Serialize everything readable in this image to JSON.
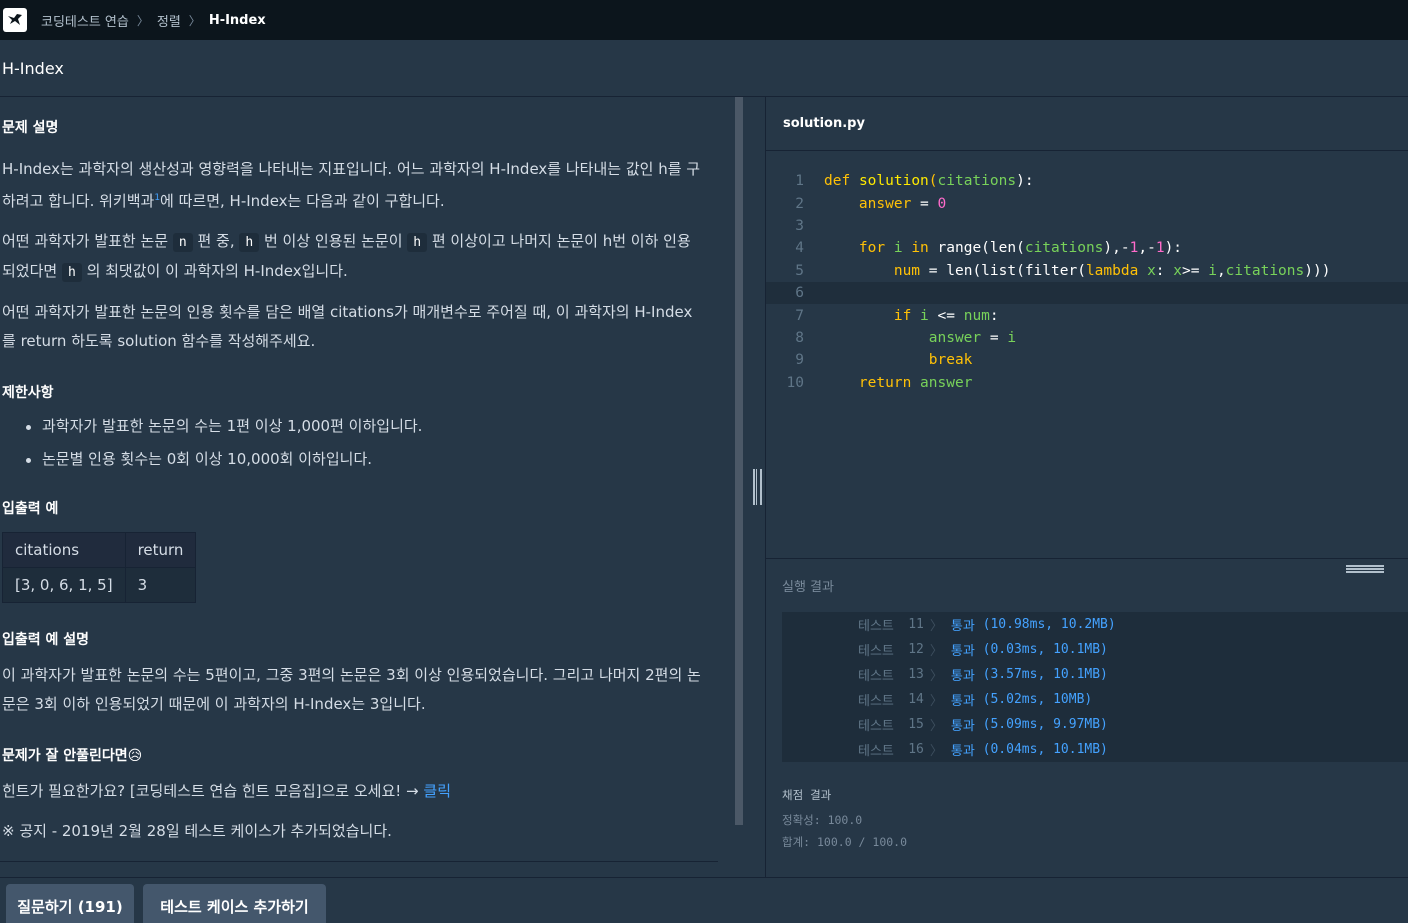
{
  "breadcrumb": {
    "items": [
      "코딩테스트 연습",
      "정렬",
      "H-Index"
    ],
    "separator": "〉"
  },
  "page": {
    "title": "H-Index"
  },
  "problem": {
    "desc_heading": "문제 설명",
    "desc_p1_a": "H-Index는 과학자의 생산성과 영향력을 나타내는 지표입니다. 어느 과학자의 H-Index를 나타내는 값인 h를 구하려고 합니다. 위키백과",
    "desc_p1_ref": "1",
    "desc_p1_b": "에 따르면, H-Index는 다음과 같이 구합니다.",
    "desc_p2_a": "어떤 과학자가 발표한 논문 ",
    "desc_p2_n": "n",
    "desc_p2_b": " 편 중, ",
    "desc_p2_h1": "h",
    "desc_p2_c": " 번 이상 인용된 논문이 ",
    "desc_p2_h2": "h",
    "desc_p2_d": " 편 이상이고 나머지 논문이 h번 이하 인용되었다면 ",
    "desc_p2_h3": "h",
    "desc_p2_e": " 의 최댓값이 이 과학자의 H-Index입니다.",
    "desc_p3": "어떤 과학자가 발표한 논문의 인용 횟수를 담은 배열 citations가 매개변수로 주어질 때, 이 과학자의 H-Index를 return 하도록 solution 함수를 작성해주세요.",
    "constraints_heading": "제한사항",
    "constraints": [
      "과학자가 발표한 논문의 수는 1편 이상 1,000편 이하입니다.",
      "논문별 인용 횟수는 0회 이상 10,000회 이하입니다."
    ],
    "io_heading": "입출력 예",
    "io_table": {
      "headers": [
        "citations",
        "return"
      ],
      "rows": [
        [
          "[3, 0, 6, 1, 5]",
          "3"
        ]
      ]
    },
    "io_explain_heading": "입출력 예 설명",
    "io_explain": "이 과학자가 발표한 논문의 수는 5편이고, 그중 3편의 논문은 3회 이상 인용되었습니다. 그리고 나머지 2편의 논문은 3회 이하 인용되었기 때문에 이 과학자의 H-Index는 3입니다.",
    "hint_heading": "문제가 잘 안풀린다면😥",
    "hint_text": "힌트가 필요한가요? [코딩테스트 연습 힌트 모음집]으로 오세요! → ",
    "hint_link": "클릭",
    "notice": "※ 공지 - 2019년 2월 28일 테스트 케이스가 추가되었습니다."
  },
  "editor": {
    "filename": "solution.py",
    "line_numbers": [
      "1",
      "2",
      "3",
      "4",
      "5",
      "6",
      "7",
      "8",
      "9",
      "10"
    ]
  },
  "results": {
    "heading": "실행 결과",
    "test_label": "테스트",
    "pass_label": "통과",
    "tests": [
      {
        "num": "11",
        "detail": "(10.98ms, 10.2MB)"
      },
      {
        "num": "12",
        "detail": "(0.03ms, 10.1MB)"
      },
      {
        "num": "13",
        "detail": "(3.57ms, 10.1MB)"
      },
      {
        "num": "14",
        "detail": "(5.02ms, 10MB)"
      },
      {
        "num": "15",
        "detail": "(5.09ms, 9.97MB)"
      },
      {
        "num": "16",
        "detail": "(0.04ms, 10.1MB)"
      }
    ],
    "grade_heading": "채점 결과",
    "accuracy": "정확성: 100.0",
    "total": "합계: 100.0 / 100.0"
  },
  "buttons": {
    "question": "질문하기 (191)",
    "add_testcase": "테스트 케이스 추가하기"
  },
  "colors": {
    "background": "#263747",
    "nav": "#0c151c",
    "keyword": "#ffc107",
    "identifier": "#78d25a",
    "number": "#ff6bcb",
    "pass": "#44a2ff",
    "button": "#44576c"
  }
}
